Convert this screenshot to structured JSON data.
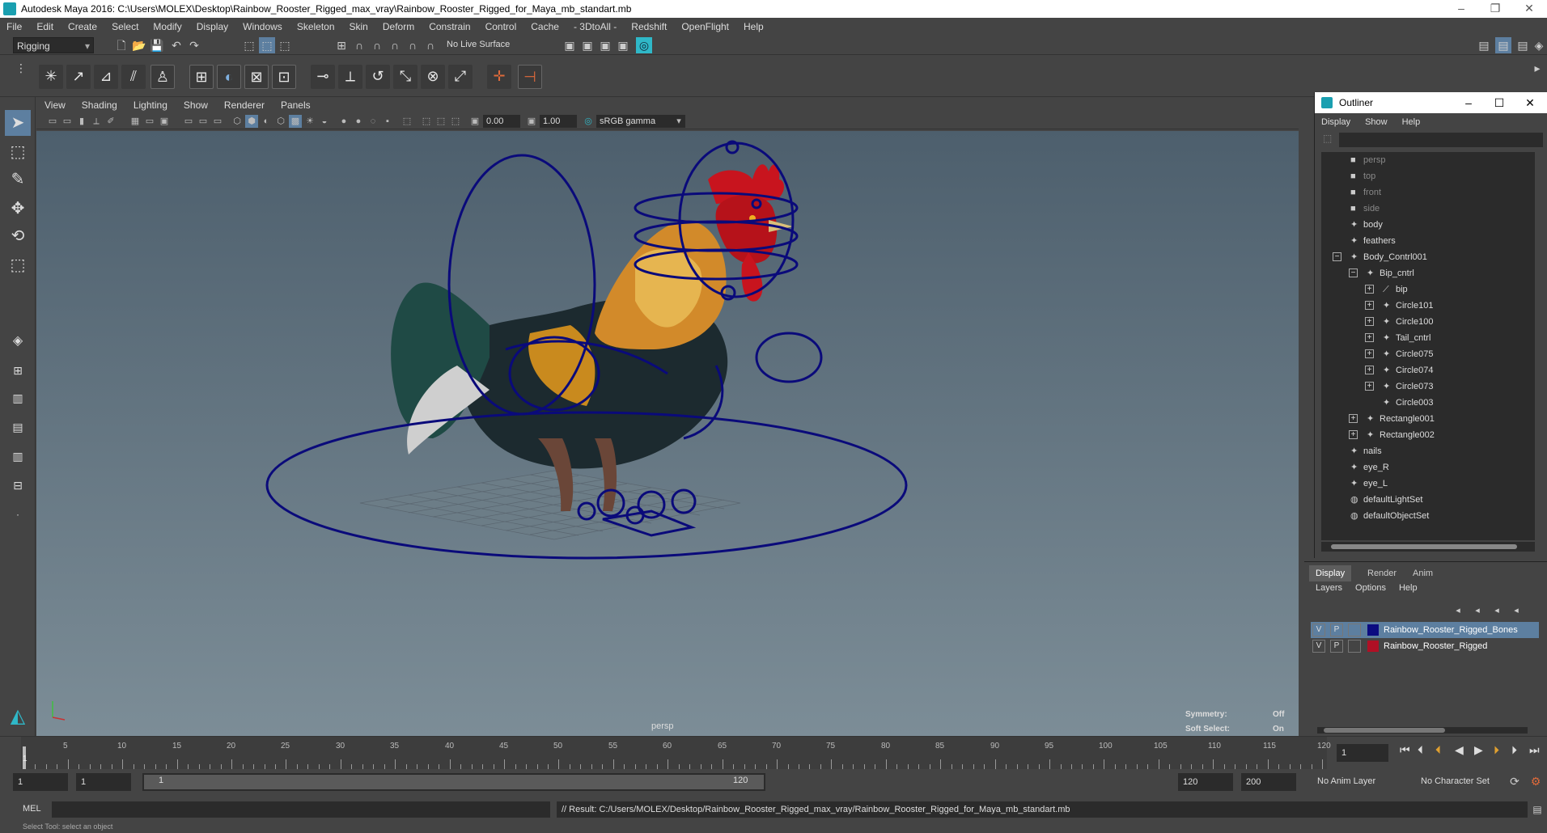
{
  "window": {
    "title": "Autodesk Maya 2016: C:\\Users\\MOLEX\\Desktop\\Rainbow_Rooster_Rigged_max_vray\\Rainbow_Rooster_Rigged_for_Maya_mb_standart.mb"
  },
  "menubar": [
    "File",
    "Edit",
    "Create",
    "Select",
    "Modify",
    "Display",
    "Windows",
    "Skeleton",
    "Skin",
    "Deform",
    "Constrain",
    "Control",
    "Cache",
    "- 3DtoAll -",
    "Redshift",
    "OpenFlight",
    "Help"
  ],
  "statusline": {
    "mode": "Rigging",
    "live_surface": "No Live Surface"
  },
  "panel": {
    "menu": [
      "View",
      "Shading",
      "Lighting",
      "Show",
      "Renderer",
      "Panels"
    ],
    "near_value": "0.00",
    "far_value": "1.00",
    "color_space": "sRGB gamma",
    "camera_label": "persp",
    "hud": {
      "symmetry_label": "Symmetry:",
      "symmetry_value": "Off",
      "soft_select_label": "Soft Select:",
      "soft_select_value": "On"
    }
  },
  "outliner": {
    "title": "Outliner",
    "menu": [
      "Display",
      "Show",
      "Help"
    ],
    "items": [
      {
        "label": "persp",
        "icon": "camera-icon",
        "dim": true,
        "depth": 0,
        "exp": ""
      },
      {
        "label": "top",
        "icon": "camera-icon",
        "dim": true,
        "depth": 0,
        "exp": ""
      },
      {
        "label": "front",
        "icon": "camera-icon",
        "dim": true,
        "depth": 0,
        "exp": ""
      },
      {
        "label": "side",
        "icon": "camera-icon",
        "dim": true,
        "depth": 0,
        "exp": ""
      },
      {
        "label": "body",
        "icon": "mesh-icon",
        "dim": false,
        "depth": 0,
        "exp": ""
      },
      {
        "label": "feathers",
        "icon": "mesh-icon",
        "dim": false,
        "depth": 0,
        "exp": ""
      },
      {
        "label": "Body_Contrl001",
        "icon": "curve-icon",
        "dim": false,
        "depth": 0,
        "exp": "−"
      },
      {
        "label": "Bip_cntrl",
        "icon": "curve-icon",
        "dim": false,
        "depth": 1,
        "exp": "−"
      },
      {
        "label": "bip",
        "icon": "joint-icon",
        "dim": false,
        "depth": 2,
        "exp": "+"
      },
      {
        "label": "Circle101",
        "icon": "curve-icon",
        "dim": false,
        "depth": 2,
        "exp": "+"
      },
      {
        "label": "Circle100",
        "icon": "curve-icon",
        "dim": false,
        "depth": 2,
        "exp": "+"
      },
      {
        "label": "Tail_cntrl",
        "icon": "curve-icon",
        "dim": false,
        "depth": 2,
        "exp": "+"
      },
      {
        "label": "Circle075",
        "icon": "curve-icon",
        "dim": false,
        "depth": 2,
        "exp": "+"
      },
      {
        "label": "Circle074",
        "icon": "curve-icon",
        "dim": false,
        "depth": 2,
        "exp": "+"
      },
      {
        "label": "Circle073",
        "icon": "curve-icon",
        "dim": false,
        "depth": 2,
        "exp": "+"
      },
      {
        "label": "Circle003",
        "icon": "curve-icon",
        "dim": false,
        "depth": 2,
        "exp": ""
      },
      {
        "label": "Rectangle001",
        "icon": "curve-icon",
        "dim": false,
        "depth": 1,
        "exp": "+"
      },
      {
        "label": "Rectangle002",
        "icon": "curve-icon",
        "dim": false,
        "depth": 1,
        "exp": "+"
      },
      {
        "label": "nails",
        "icon": "mesh-icon",
        "dim": false,
        "depth": 0,
        "exp": ""
      },
      {
        "label": "eye_R",
        "icon": "mesh-icon",
        "dim": false,
        "depth": 0,
        "exp": ""
      },
      {
        "label": "eye_L",
        "icon": "mesh-icon",
        "dim": false,
        "depth": 0,
        "exp": ""
      },
      {
        "label": "defaultLightSet",
        "icon": "set-icon",
        "dim": false,
        "depth": 0,
        "exp": ""
      },
      {
        "label": "defaultObjectSet",
        "icon": "set-icon",
        "dim": false,
        "depth": 0,
        "exp": ""
      }
    ]
  },
  "layer_panel": {
    "tabs": [
      "Display",
      "Render",
      "Anim"
    ],
    "active_tab": "Display",
    "menu": [
      "Layers",
      "Options",
      "Help"
    ],
    "layers": [
      {
        "v": "V",
        "p": "P",
        "name": "Rainbow_Rooster_Rigged_Bones",
        "color": "#0b0b80",
        "selected": true
      },
      {
        "v": "V",
        "p": "P",
        "name": "Rainbow_Rooster_Rigged",
        "color": "#b01025",
        "selected": false
      }
    ]
  },
  "timeline": {
    "ticks": [
      "5",
      "10",
      "15",
      "20",
      "25",
      "30",
      "35",
      "40",
      "45",
      "50",
      "55",
      "60",
      "65",
      "70",
      "75",
      "80",
      "85",
      "90",
      "95",
      "100",
      "105",
      "110",
      "115",
      "120"
    ],
    "first": "1",
    "current_frame": "1"
  },
  "range": {
    "start": "1",
    "anim_start": "1",
    "slider_start": "1",
    "slider_end": "120",
    "end": "120",
    "anim_end": "200",
    "anim_layer": "No Anim Layer",
    "character_set": "No Character Set"
  },
  "command": {
    "language": "MEL",
    "result": "// Result: C:/Users/MOLEX/Desktop/Rainbow_Rooster_Rigged_max_vray/Rainbow_Rooster_Rigged_for_Maya_mb_standart.mb"
  },
  "helpline": "Select Tool: select an object",
  "colors": {
    "rig_curve": "#0a0a7a",
    "viewport_top": "#4d5f6d",
    "viewport_bottom": "#7c8d97",
    "comb": "#c8141e"
  }
}
